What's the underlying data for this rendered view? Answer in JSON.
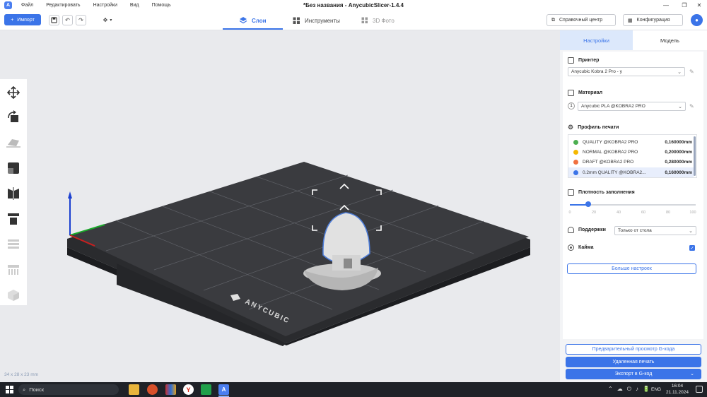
{
  "titlebar": {
    "title": "*Без названия - AnycubicSlicer-1.4.4",
    "menu": [
      "Файл",
      "Редактировать",
      "Настройки",
      "Вид",
      "Помощь"
    ]
  },
  "toolbar": {
    "import_label": "Импорт",
    "tabs": [
      {
        "label": "Слои",
        "active": true
      },
      {
        "label": "Инструменты",
        "active": false
      },
      {
        "label": "3D Фото",
        "active": false
      }
    ],
    "help_label": "Справочный центр",
    "config_label": "Конфигурация"
  },
  "viewport": {
    "dimensions": "34 x 28 x 23 mm",
    "bed_brand": "ANYCUBIC"
  },
  "panel": {
    "tabs": [
      "Настройки",
      "Модель"
    ],
    "printer": {
      "title": "Принтер",
      "value": "Anycubic Kobra 2 Pro - у"
    },
    "material": {
      "title": "Материал",
      "index": "1",
      "value": "Anycubic PLA @KOBRA2 PRO"
    },
    "profile": {
      "title": "Профиль печати",
      "items": [
        {
          "name": "QUALITY @KOBRA2 PRO",
          "value": "0,160000mm",
          "color": "#4caf50"
        },
        {
          "name": "NORMAL @KOBRA2 PRO",
          "value": "0,200000mm",
          "color": "#f5b800"
        },
        {
          "name": "DRAFT @KOBRA2 PRO",
          "value": "0,280000mm",
          "color": "#f07040"
        },
        {
          "name": "0.2mm QUALITY @KOBRA2...",
          "value": "0,160000mm",
          "color": "#3b74e8"
        }
      ]
    },
    "infill": {
      "title": "Плотность заполнения",
      "value_percent": 15,
      "ticks": [
        "0",
        "20",
        "40",
        "60",
        "80",
        "100"
      ]
    },
    "supports": {
      "title": "Поддержки",
      "value": "Только от стола"
    },
    "brim": {
      "title": "Кайма",
      "checked": true
    },
    "more_settings": "Больше настроек",
    "preview_gcode": "Предварительный просмотр G-кода",
    "remote_print": "Удаленная печать",
    "export_gcode": "Экспорт в G-код"
  },
  "taskbar": {
    "search": "Поиск",
    "lang": "ENG",
    "time": "16:04",
    "date": "21.11.2024"
  }
}
